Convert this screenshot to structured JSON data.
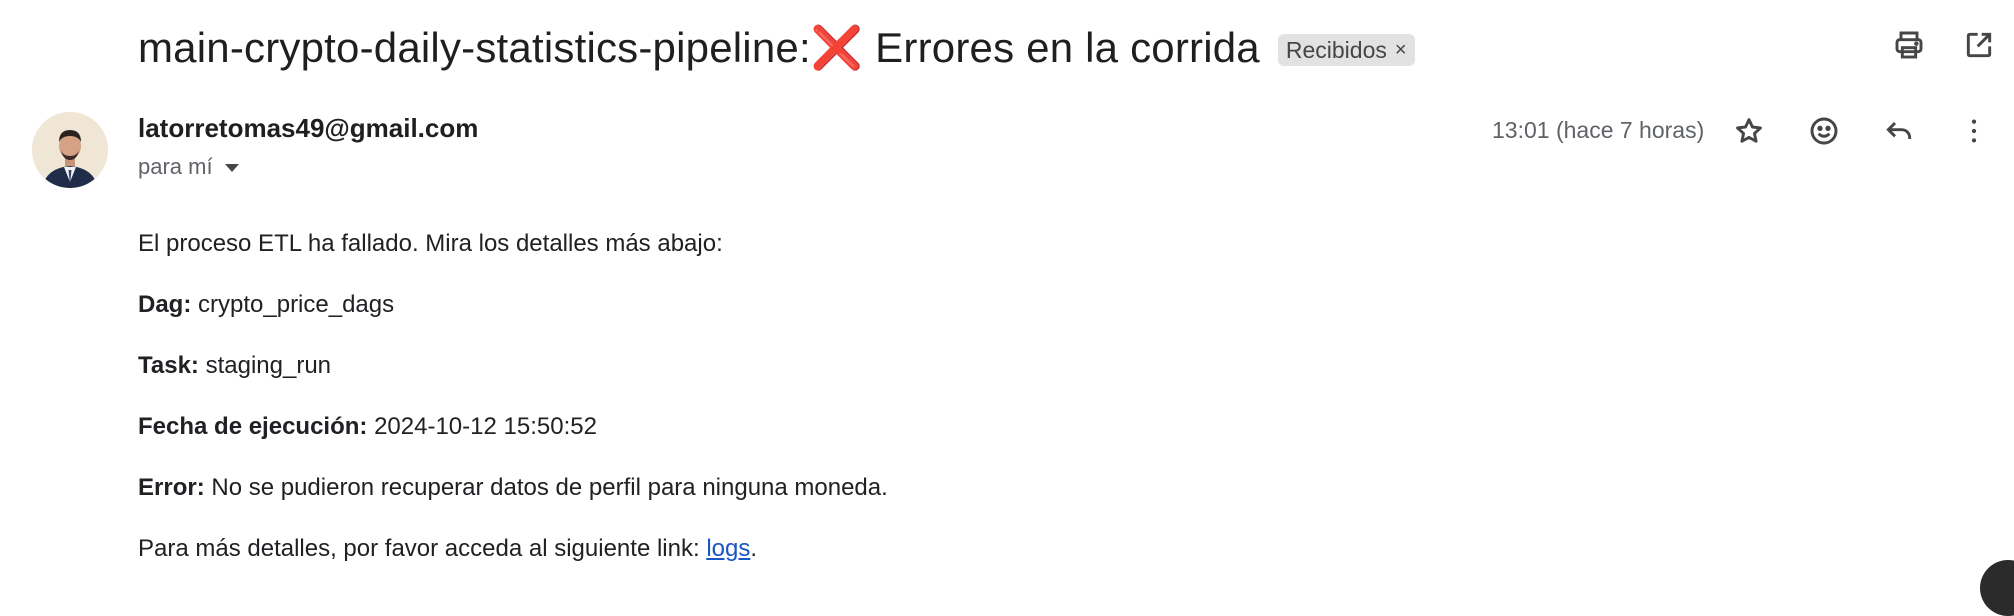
{
  "email": {
    "subject_prefix": "main-crypto-daily-statistics-pipeline:",
    "subject_emoji": "❌",
    "subject_suffix": " Errores en la corrida",
    "label_chip": "Recibidos",
    "label_chip_close": "×",
    "sender": "latorretomas49@gmail.com",
    "recipient": "para mí",
    "timestamp": "13:01 (hace 7 horas)",
    "body": {
      "intro": "El proceso ETL ha fallado. Mira los detalles más abajo:",
      "dag_label": "Dag:",
      "dag_value": " crypto_price_dags",
      "task_label": "Task:",
      "task_value": " staging_run",
      "fecha_label": "Fecha de ejecución:",
      "fecha_value": " 2024-10-12 15:50:52",
      "error_label": "Error:",
      "error_value": " No se pudieron recuperar datos de perfil para ninguna moneda.",
      "details_prefix": "Para más detalles, por favor acceda al siguiente link: ",
      "details_link": "logs",
      "details_suffix": "."
    }
  },
  "icons": {
    "print": "print-icon",
    "open_new_window": "open-in-new-window-icon",
    "star": "star-icon",
    "emoji": "emoji-reaction-icon",
    "reply": "reply-icon",
    "more": "more-vert-icon",
    "dropdown": "chevron-down-icon"
  },
  "colors": {
    "link": "#1a55c4",
    "chip_bg": "#e2e2e2",
    "avatar_bg": "#efe6d6",
    "emoji_red": "#e8262c"
  }
}
